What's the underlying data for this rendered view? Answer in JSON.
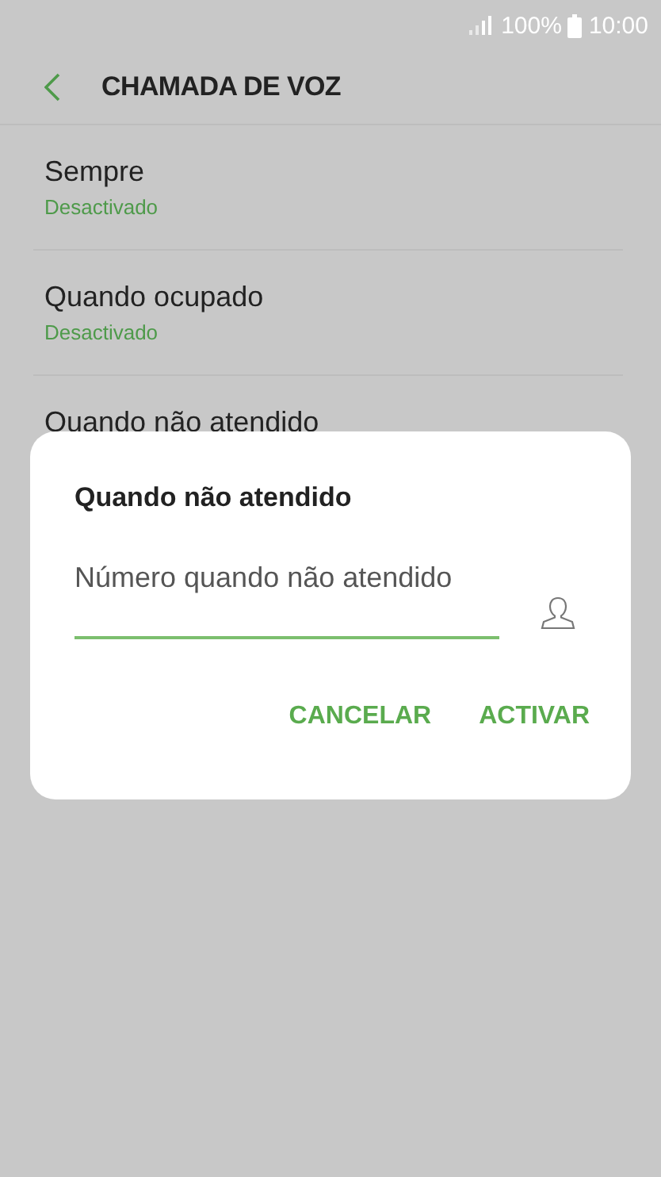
{
  "status_bar": {
    "battery": "100%",
    "time": "10:00"
  },
  "header": {
    "title": "CHAMADA DE VOZ"
  },
  "items": [
    {
      "title": "Sempre",
      "status": "Desactivado"
    },
    {
      "title": "Quando ocupado",
      "status": "Desactivado"
    },
    {
      "title": "Quando não atendido"
    }
  ],
  "dialog": {
    "title": "Quando não atendido",
    "field": {
      "placeholder": "Número quando não atendido"
    },
    "buttons": [
      "CANCELAR",
      "ACTIVAR"
    ]
  }
}
